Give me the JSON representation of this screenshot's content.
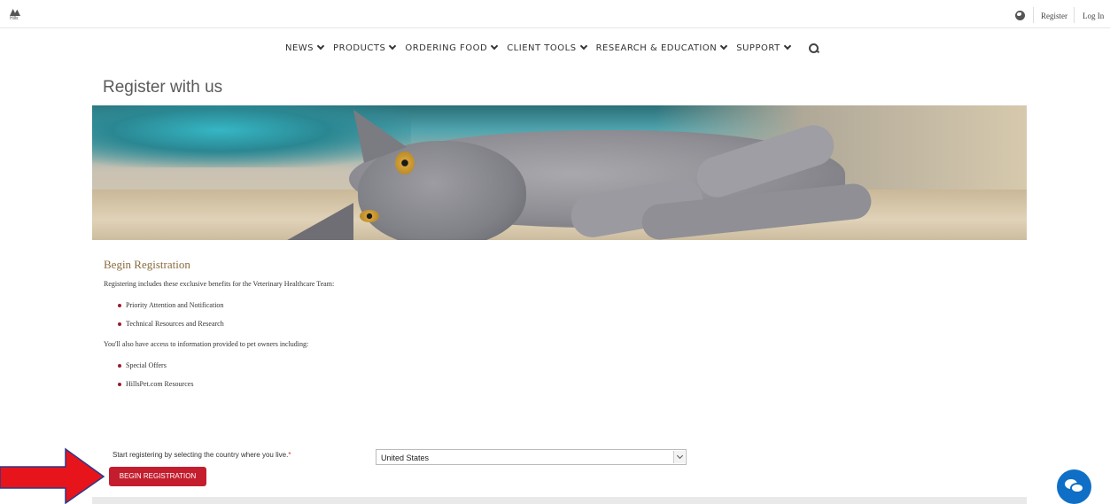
{
  "header": {
    "logo_text": "Hills",
    "register_label": "Register",
    "login_label": "Log In"
  },
  "nav": {
    "items": [
      {
        "label": "NEWS"
      },
      {
        "label": "PRODUCTS"
      },
      {
        "label": "ORDERING FOOD"
      },
      {
        "label": "CLIENT TOOLS"
      },
      {
        "label": "RESEARCH & EDUCATION"
      },
      {
        "label": "SUPPORT"
      }
    ]
  },
  "page": {
    "title": "Register with us"
  },
  "registration": {
    "heading": "Begin Registration",
    "intro": "Registering includes these exclusive benefits for the Veterinary Healthcare Team:",
    "benefits": [
      "Priority Attention and Notification",
      "Technical Resources and Research"
    ],
    "owner_intro": "You'll also have access to information provided to pet owners including:",
    "owner_benefits": [
      "Special Offers",
      "HillsPet.com Resources"
    ],
    "country_label": "Start registering by selecting the country where you live.",
    "required_mark": "*",
    "country_value": "United States",
    "button_label": "BEGIN REGISTRATION"
  },
  "colors": {
    "accent_red": "#c41e2e",
    "heading_brown": "#8a6c3d",
    "chat_blue": "#0f6fc6"
  },
  "icons": [
    "globe-icon",
    "chevron-down-icon",
    "search-icon",
    "chat-icon",
    "red-arrow-annotation"
  ]
}
